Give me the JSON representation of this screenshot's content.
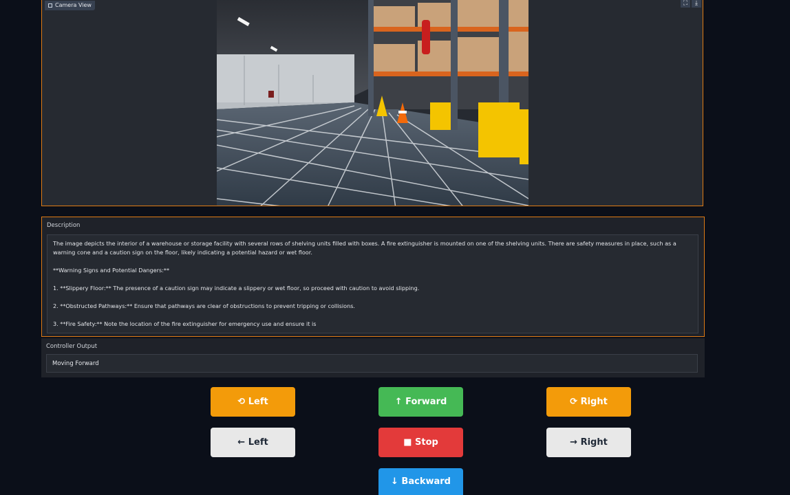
{
  "camera": {
    "label": "Camera View",
    "fullscreen_icon": "⛶",
    "download_icon": "⤓"
  },
  "description": {
    "label": "Description",
    "paragraphs": [
      "The image depicts the interior of a warehouse or storage facility with several rows of shelving units filled with boxes. A fire extinguisher is mounted on one of the shelving units. There are safety measures in place, such as a warning cone and a caution sign on the floor, likely indicating a potential hazard or wet floor.",
      "**Warning Signs and Potential Dangers:**",
      "1. **Slippery Floor:** The presence of a caution sign may indicate a slippery or wet floor, so proceed with caution to avoid slipping.",
      "2. **Obstructed Pathways:** Ensure that pathways are clear of obstructions to prevent tripping or collisions.",
      "3. **Fire Safety:** Note the location of the fire extinguisher for emergency use and ensure it is"
    ]
  },
  "controller": {
    "label": "Controller Output",
    "value": "Moving Forward"
  },
  "buttons": {
    "rotate_left": "⟲ Left",
    "forward": "↑ Forward",
    "rotate_right": "⟳ Right",
    "left": "← Left",
    "stop": "■ Stop",
    "right": "→ Right",
    "backward": "↓ Backward"
  },
  "colors": {
    "accent_border": "#e07b14",
    "orange": "#f39b0a",
    "green": "#45b955",
    "red": "#e33a3a",
    "blue": "#2196e8",
    "light": "#e8e8e8"
  }
}
